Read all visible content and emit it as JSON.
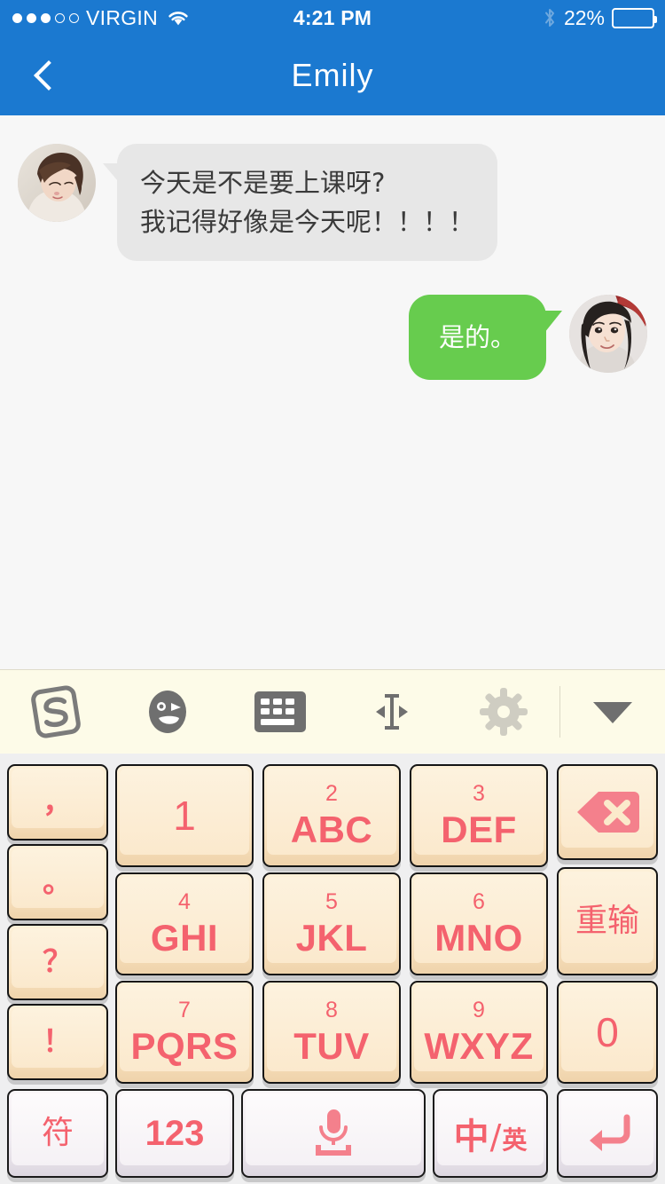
{
  "status_bar": {
    "carrier": "VIRGIN",
    "signal_dots_total": 5,
    "signal_dots_filled": 3,
    "wifi_icon": "wifi-icon",
    "time": "4:21 PM",
    "bluetooth_icon": "bluetooth-icon",
    "battery_percent": "22%",
    "battery_level": 22
  },
  "nav": {
    "back_icon": "chevron-left-icon",
    "title": "Emily"
  },
  "chat": {
    "messages": [
      {
        "id": "msg-1",
        "side": "incoming",
        "sender": "Emily",
        "avatar": "avatar-emily",
        "lines": [
          "今天是不是要上课呀?",
          "我记得好像是今天呢！！！！"
        ],
        "bubble_color": "#e7e7e7",
        "text_color": "#3a3a3a"
      },
      {
        "id": "msg-2",
        "side": "outgoing",
        "sender": "me",
        "avatar": "avatar-me",
        "lines": [
          "是的。"
        ],
        "bubble_color": "#67cc4e",
        "text_color": "#ffffff"
      }
    ]
  },
  "keyboard_toolbar": {
    "items": [
      {
        "name": "sogou-logo-icon",
        "label": "S"
      },
      {
        "name": "emoji-face-icon",
        "label": ""
      },
      {
        "name": "keyboard-icon",
        "label": ""
      },
      {
        "name": "cursor-move-icon",
        "label": ""
      },
      {
        "name": "gear-icon",
        "label": ""
      }
    ],
    "collapse": {
      "name": "chevron-down-icon",
      "label": ""
    }
  },
  "keyboard": {
    "background": "#efeff0",
    "key_face": "#fbeacb",
    "key_text": "#f4626e",
    "punct_column": [
      {
        "name": "key-comma",
        "label": "，"
      },
      {
        "name": "key-period",
        "label": "。"
      },
      {
        "name": "key-question",
        "label": "？"
      },
      {
        "name": "key-exclaim",
        "label": "！"
      }
    ],
    "numeric_keys": [
      {
        "name": "key-1",
        "num": "1",
        "alpha": ""
      },
      {
        "name": "key-2",
        "num": "2",
        "alpha": "ABC"
      },
      {
        "name": "key-3",
        "num": "3",
        "alpha": "DEF"
      },
      {
        "name": "key-4",
        "num": "4",
        "alpha": "GHI"
      },
      {
        "name": "key-5",
        "num": "5",
        "alpha": "JKL"
      },
      {
        "name": "key-6",
        "num": "6",
        "alpha": "MNO"
      },
      {
        "name": "key-7",
        "num": "7",
        "alpha": "PQRS"
      },
      {
        "name": "key-8",
        "num": "8",
        "alpha": "TUV"
      },
      {
        "name": "key-9",
        "num": "9",
        "alpha": "WXYZ"
      }
    ],
    "right_column": [
      {
        "name": "key-backspace",
        "label": "",
        "icon": "backspace-icon"
      },
      {
        "name": "key-redo",
        "label": "重输",
        "icon": ""
      },
      {
        "name": "key-0",
        "label": "0",
        "icon": ""
      }
    ],
    "bottom_row": [
      {
        "name": "key-symbols",
        "label": "符",
        "icon": ""
      },
      {
        "name": "key-123",
        "label": "123",
        "icon": ""
      },
      {
        "name": "key-voice",
        "label": "",
        "icon": "microphone-icon"
      },
      {
        "name": "key-lang-toggle",
        "label": "中/英",
        "label_main": "中",
        "label_slash": "/",
        "label_sub": "英",
        "icon": ""
      },
      {
        "name": "key-enter",
        "label": "",
        "icon": "enter-arrow-icon"
      }
    ]
  }
}
